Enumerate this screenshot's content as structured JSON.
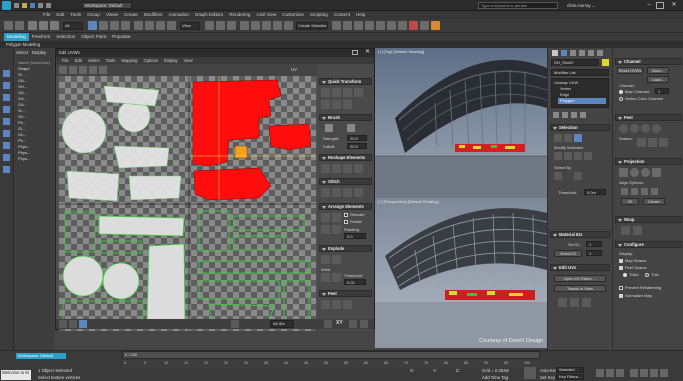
{
  "app": {
    "workspace_label": "Workspace: Default",
    "search_placeholder": "Type a keyword or phrase",
    "user": "chris.murray ...",
    "brand_color": "#2aa0c8"
  },
  "menubar": [
    "File",
    "Edit",
    "Tools",
    "Group",
    "Views",
    "Create",
    "Modifiers",
    "Animation",
    "Graph Editors",
    "Rendering",
    "Civil View",
    "Customize",
    "Scripting",
    "Content",
    "Help"
  ],
  "ribbon": {
    "tabs": [
      "Modeling",
      "Freeform",
      "Selection",
      "Object Paint",
      "Populate"
    ],
    "sub": "Polygon Modeling",
    "view_dropdown": "View",
    "selection_set": "Create Selection Se"
  },
  "scene_explorer": {
    "tabs": [
      "Select",
      "Display"
    ],
    "rows": [
      "Name (Sorted As)",
      "Shape",
      "Sl...",
      "GA...",
      "GH...",
      "GA...",
      "GA...",
      "GA...",
      "Sl...",
      "Gh...",
      "Ph...",
      "Gl...",
      "Gh...",
      "Ph...",
      "Phys...",
      "Phys...",
      "Phys..."
    ]
  },
  "uv_editor": {
    "title": "Edit UVWs",
    "menu": [
      "File",
      "Edit",
      "Select",
      "Tools",
      "Mapping",
      "Options",
      "Display",
      "View"
    ],
    "uv_label": "UV",
    "checker": "CheckerPatt...( Checker )",
    "zoom_value": "All IDs",
    "quick_transform": "Quick Transform",
    "brush": "Brush",
    "strength_label": "Strength:",
    "strength_value": "20.0",
    "falloff_label": "Falloff:",
    "falloff_value": "20.0",
    "reshape": "Reshape Elements",
    "stitch": "Stitch",
    "arrange": "Arrange Elements",
    "rescale": "Rescale",
    "rotate": "Rotate",
    "padding_label": "Padding:",
    "padding_value": "0.0",
    "explode": "Explode",
    "weld": "Weld",
    "threshold_label": "Threshold:",
    "threshold_value": "0.01",
    "peel": "Peel",
    "xy_label": "XY"
  },
  "viewports": {
    "top_label": "[+] [Top] [Default Shading]",
    "bottom_label": "[+] [Perspective] [Default Shading]",
    "credit": "Courtesy of Dosch Design"
  },
  "command_panel": {
    "object_name": "GH_Shell2",
    "modifier_list": "Modifier List",
    "stack": [
      "Unwrap UVW",
      "Vertex",
      "Edge",
      "Polygon"
    ],
    "selection": "Selection",
    "modify_selection": "Modify Selection",
    "select_by": "Select By",
    "threshold_label": "Threshold:",
    "threshold_value": "0.0m",
    "material_ids": "Material IDs",
    "set_id": "Set ID:",
    "set_id_value": "1",
    "select_id": "Select ID",
    "select_id_value": "1",
    "edit_uvs": "Edit UVs",
    "open_uv_editor": "Open UV Editor ...",
    "tweak_view": "Tweak In View"
  },
  "channel_panel": {
    "channel": "Channel",
    "reset_uvws": "Reset UVWs",
    "save": "Save...",
    "load": "Load...",
    "channel_label": "Channel:",
    "map_channel": "Map Channel:",
    "map_channel_value": "1",
    "vertex_color": "Vertex Color Channel",
    "peel": "Peel",
    "seams": "Seams:",
    "projection": "Projection",
    "align_options": "Align Options:",
    "fit": "Fit",
    "center": "Center",
    "wrap": "Wrap",
    "configure": "Configure",
    "display": "Display:",
    "map_seams": "Map Seams",
    "peel_seams": "Peel Seams",
    "thick": "Thick",
    "thin": "Thin",
    "prevent_reflattening": "Prevent Reflattening",
    "normalize_map": "Normalize Map"
  },
  "timeline": {
    "frame": "0 / 100",
    "ticks": [
      "0",
      "5",
      "10",
      "15",
      "20",
      "25",
      "30",
      "35",
      "40",
      "45",
      "50",
      "55",
      "60",
      "65",
      "70",
      "75",
      "80",
      "85",
      "90",
      "95",
      "100"
    ],
    "status": "1 Object Selected",
    "prompt": "Select texture vertices",
    "welcome": "Welcome to M",
    "grid": "Grid = 0.254m",
    "add_time_tag": "Add Time Tag",
    "auto_key": "Auto Key",
    "selected": "Selected",
    "set_key": "Set Key",
    "key_filters": "Key Filters...",
    "x_label": "X:",
    "y_label": "Y:",
    "z_label": "Z:"
  }
}
